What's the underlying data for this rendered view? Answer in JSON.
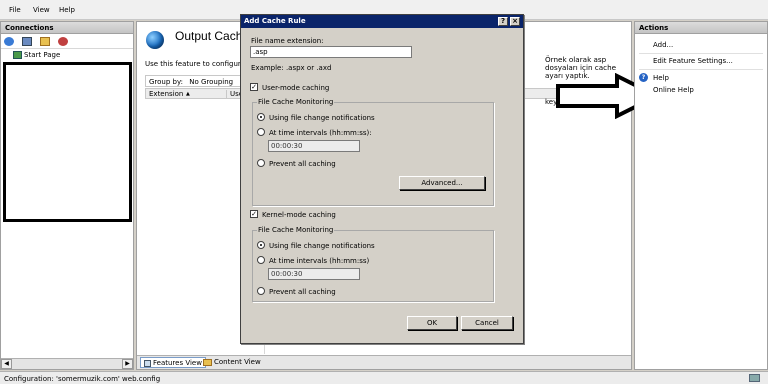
{
  "menubar": {
    "items": [
      "File",
      "View",
      "Help"
    ]
  },
  "connections": {
    "title": "Connections",
    "tree_item": "Start Page",
    "toolbar_icons": [
      "connect-icon",
      "save-icon",
      "folder-icon",
      "disconnect-icon"
    ]
  },
  "center": {
    "title": "Output Cach",
    "description": "Use this feature to configure c",
    "group_by_label": "Group by:",
    "group_by_value": "No Grouping",
    "columns": [
      "Extension",
      "Use"
    ],
    "note": "Örnek olarak asp dosyaları için cache ayarı yaptık.",
    "row_value": "keykubad.com"
  },
  "bottom_tabs": {
    "features_view": "Features View",
    "content_view": "Content View"
  },
  "actions": {
    "title": "Actions",
    "items": [
      "Add...",
      "Edit Feature Settings...",
      "Help",
      "Online Help"
    ]
  },
  "status": {
    "text": "Configuration: 'somermuzik.com' web.config"
  },
  "dialog": {
    "title": "Add Cache Rule",
    "help_button": "?",
    "close_button": "×",
    "ext_label": "File name extension:",
    "ext_value": ".asp",
    "example": "Example: .aspx or .axd",
    "user_mode": {
      "label": "User-mode caching",
      "checked": true
    },
    "kernel_mode": {
      "label": "Kernel-mode caching",
      "checked": true
    },
    "group1": {
      "title": "File Cache Monitoring",
      "opt1": "Using file change notifications",
      "opt2": "At time intervals (hh:mm:ss):",
      "interval": "00:00:30",
      "opt3": "Prevent all caching",
      "advanced": "Advanced..."
    },
    "group2": {
      "title": "File Cache Monitoring",
      "opt1": "Using file change notifications",
      "opt2": "At time intervals (hh:mm:ss)",
      "interval": "00:00:30",
      "opt3": "Prevent all caching"
    },
    "ok": "OK",
    "cancel": "Cancel"
  }
}
